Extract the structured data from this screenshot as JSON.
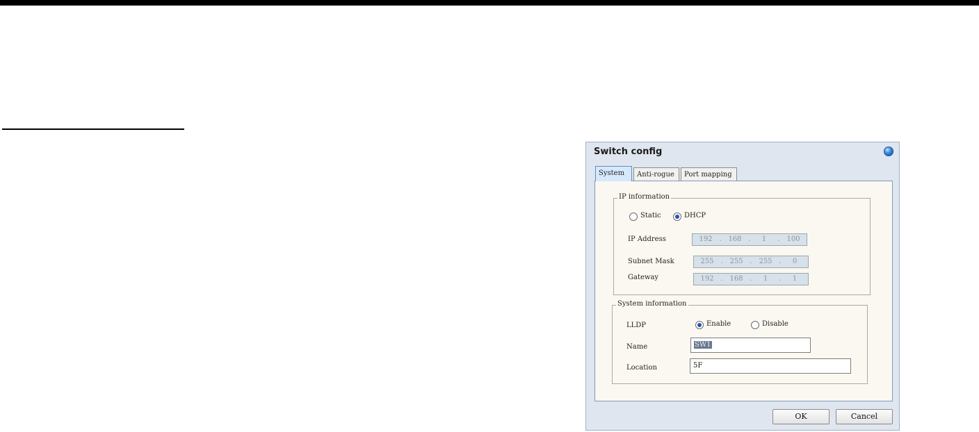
{
  "dialog": {
    "title": "Switch config",
    "help_icon": "help-icon"
  },
  "tabs": [
    {
      "label": "System",
      "active": true
    },
    {
      "label": "Anti-rogue",
      "active": false
    },
    {
      "label": "Port mapping",
      "active": false
    }
  ],
  "ip_info": {
    "legend": "IP information",
    "mode_static_label": "Static",
    "mode_dhcp_label": "DHCP",
    "selected_mode": "DHCP",
    "ip_label": "IP Address",
    "ip": [
      "192",
      "168",
      "1",
      "100"
    ],
    "mask_label": "Subnet Mask",
    "mask": [
      "255",
      "255",
      "255",
      "0"
    ],
    "gateway_label": "Gateway",
    "gateway": [
      "192",
      "168",
      "1",
      "1"
    ]
  },
  "sys_info": {
    "legend": "System information",
    "lldp_label": "LLDP",
    "lldp_enable_label": "Enable",
    "lldp_disable_label": "Disable",
    "lldp_selected": "Enable",
    "name_label": "Name",
    "name_value": "SW1",
    "location_label": "Location",
    "location_value": "5F"
  },
  "buttons": {
    "ok_label": "OK",
    "cancel_label": "Cancel"
  },
  "colors": {
    "dialog_bg": "#dfe6ef",
    "panel_bg": "#faf8f0",
    "radio_accent": "#1f55b8"
  }
}
